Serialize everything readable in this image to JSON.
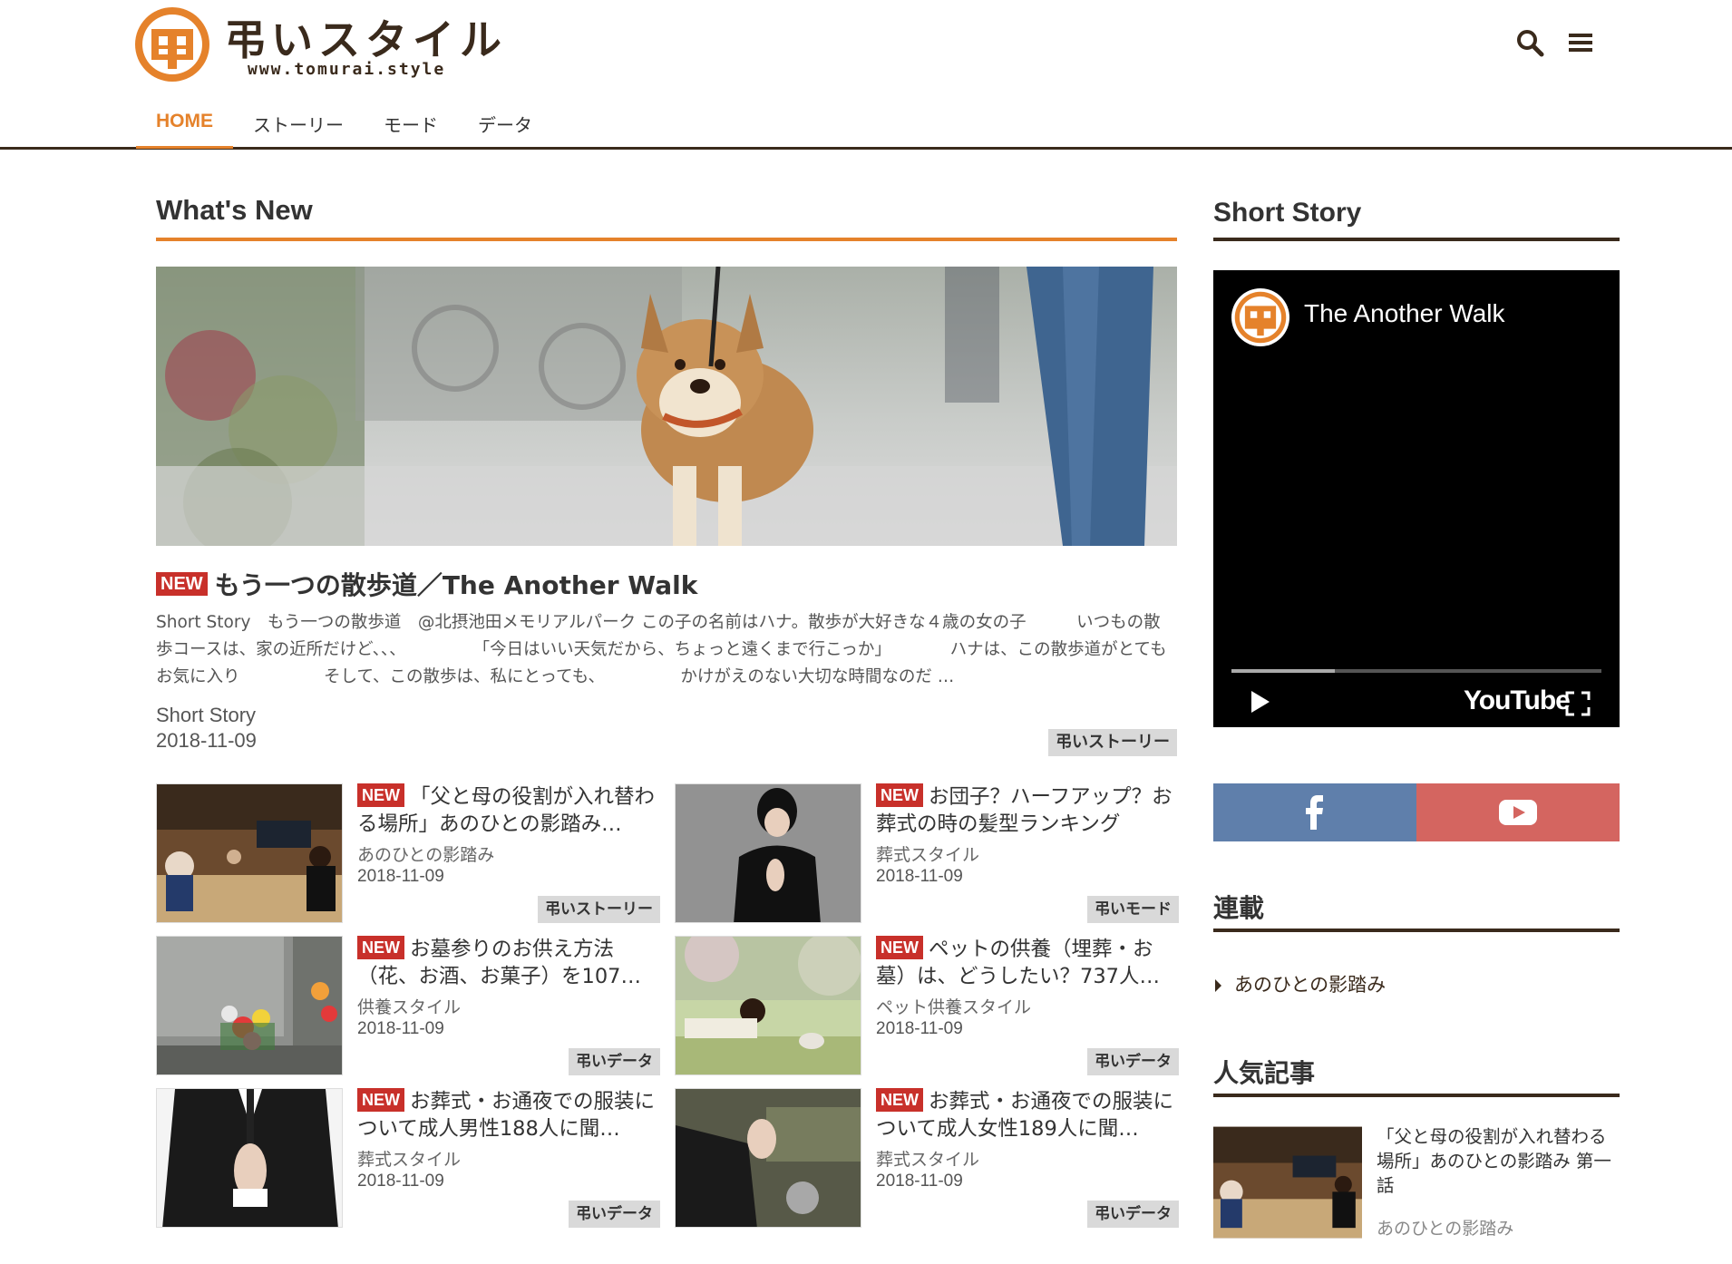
{
  "header": {
    "logo_text": "弔いスタイル",
    "logo_url": "www.tomurai.style",
    "nav": [
      {
        "label": "HOME",
        "active": true
      },
      {
        "label": "ストーリー",
        "active": false
      },
      {
        "label": "モード",
        "active": false
      },
      {
        "label": "データ",
        "active": false
      }
    ]
  },
  "colors": {
    "accent": "#e5822b",
    "brand_dark": "#3a2a1c",
    "badge_red": "#c8302a",
    "facebook": "#5f7fab",
    "youtube": "#d46560"
  },
  "main": {
    "section_title": "What's New",
    "hero": {
      "badge": "NEW",
      "title": "もう一つの散歩道／The Another Walk",
      "excerpt": "Short Story　もう一つの散歩道　@北摂池田メモリアルパーク この子の名前はハナ。散歩が大好きな４歳の女の子　　　いつもの散歩コースは、家の近所だけど、、、　　　　　「今日はいい天気だから、ちょっと遠くまで行こっか」　　　　ハナは、この散歩道がとてもお気に入り　　　　　そして、この散歩は、私にとっても、　　　　　かけがえのない大切な時間なのだ …",
      "category": "Short Story",
      "date": "2018-11-09",
      "tag": "弔いストーリー"
    },
    "cards": [
      {
        "badge": "NEW",
        "title": "「父と母の役割が入れ替わる場所」あのひとの影踏み…",
        "category": "あのひとの影踏み",
        "date": "2018-11-09",
        "tag": "弔いストーリー"
      },
      {
        "badge": "NEW",
        "title": "お団子？ハーフアップ？お葬式の時の髪型ランキング",
        "category": "葬式スタイル",
        "date": "2018-11-09",
        "tag": "弔いモード"
      },
      {
        "badge": "NEW",
        "title": "お墓参りのお供え方法（花、お酒、お菓子）を107…",
        "category": "供養スタイル",
        "date": "2018-11-09",
        "tag": "弔いデータ"
      },
      {
        "badge": "NEW",
        "title": "ペットの供養（埋葬・お墓）は、どうしたい？737人…",
        "category": "ペット供養スタイル",
        "date": "2018-11-09",
        "tag": "弔いデータ"
      },
      {
        "badge": "NEW",
        "title": "お葬式・お通夜での服装について成人男性188人に聞…",
        "category": "葬式スタイル",
        "date": "2018-11-09",
        "tag": "弔いデータ"
      },
      {
        "badge": "NEW",
        "title": "お葬式・お通夜での服装について成人女性189人に聞…",
        "category": "葬式スタイル",
        "date": "2018-11-09",
        "tag": "弔いデータ"
      }
    ]
  },
  "sidebar": {
    "short_story_title": "Short Story",
    "video": {
      "title": "The Another Walk",
      "brand": "YouTube",
      "progress": 0.28
    },
    "series_title": "連載",
    "series_links": [
      "あのひとの影踏み"
    ],
    "popular_title": "人気記事",
    "popular": [
      {
        "title": "「父と母の役割が入れ替わる場所」あのひとの影踏み 第一話",
        "category": "あのひとの影踏み"
      }
    ]
  }
}
